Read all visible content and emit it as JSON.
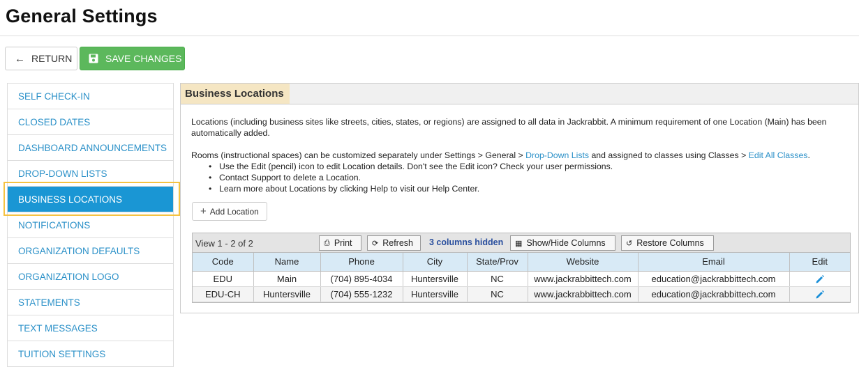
{
  "page": {
    "title": "General Settings"
  },
  "toolbar": {
    "return_label": "RETURN",
    "save_label": "SAVE CHANGES"
  },
  "sidebar": {
    "items": [
      {
        "label": "SELF CHECK-IN"
      },
      {
        "label": "CLOSED DATES"
      },
      {
        "label": "DASHBOARD ANNOUNCEMENTS"
      },
      {
        "label": "DROP-DOWN LISTS"
      },
      {
        "label": "BUSINESS LOCATIONS",
        "active": true
      },
      {
        "label": "NOTIFICATIONS"
      },
      {
        "label": "ORGANIZATION DEFAULTS"
      },
      {
        "label": "ORGANIZATION LOGO"
      },
      {
        "label": "STATEMENTS"
      },
      {
        "label": "TEXT MESSAGES"
      },
      {
        "label": "TUITION SETTINGS"
      }
    ]
  },
  "panel": {
    "title": "Business Locations",
    "intro": "Locations (including business sites like streets, cities, states, or regions) are assigned to all data in Jackrabbit. A minimum requirement of one Location (Main) has been automatically added.",
    "rooms_text_1": "Rooms (instructional spaces) can be customized separately under Settings > General > ",
    "rooms_link_1": "Drop-Down Lists",
    "rooms_text_2": " and assigned to classes using Classes > ",
    "rooms_link_2": "Edit All Classes",
    "rooms_text_3": ".",
    "bullets": [
      "Use the Edit (pencil) icon to edit Location details. Don't see the Edit icon? Check your user permissions.",
      "Contact Support to delete a Location.",
      "Learn more about Locations by clicking Help to visit our Help Center."
    ],
    "add_label": "Add Location"
  },
  "grid": {
    "view_info": "View 1 - 2 of 2",
    "print_label": "Print",
    "refresh_label": "Refresh",
    "hidden_note": "3 columns hidden",
    "showhide_label": "Show/Hide Columns",
    "restore_label": "Restore Columns",
    "columns": [
      "Code",
      "Name",
      "Phone",
      "City",
      "State/Prov",
      "Website",
      "Email",
      "Edit"
    ],
    "rows": [
      [
        "EDU",
        "Main",
        "(704) 895-4034",
        "Huntersville",
        "NC",
        "www.jackrabbittech.com",
        "education@jackrabbittech.com"
      ],
      [
        "EDU-CH",
        "Huntersville",
        "(704) 555-1232",
        "Huntersville",
        "NC",
        "www.jackrabbittech.com",
        "education@jackrabbittech.com"
      ]
    ]
  },
  "colors": {
    "accent": "#1a96d4",
    "save": "#5cb85c",
    "highlight": "#f5c242",
    "panel_tab": "#f5e6c3",
    "link": "#2a90c8"
  },
  "icons": {
    "return": "arrow-left-icon",
    "save": "floppy-disk-icon",
    "add": "plus-icon",
    "print": "printer-icon",
    "refresh": "refresh-icon",
    "showhide": "grid-icon",
    "restore": "restore-icon",
    "edit": "pencil-icon"
  }
}
